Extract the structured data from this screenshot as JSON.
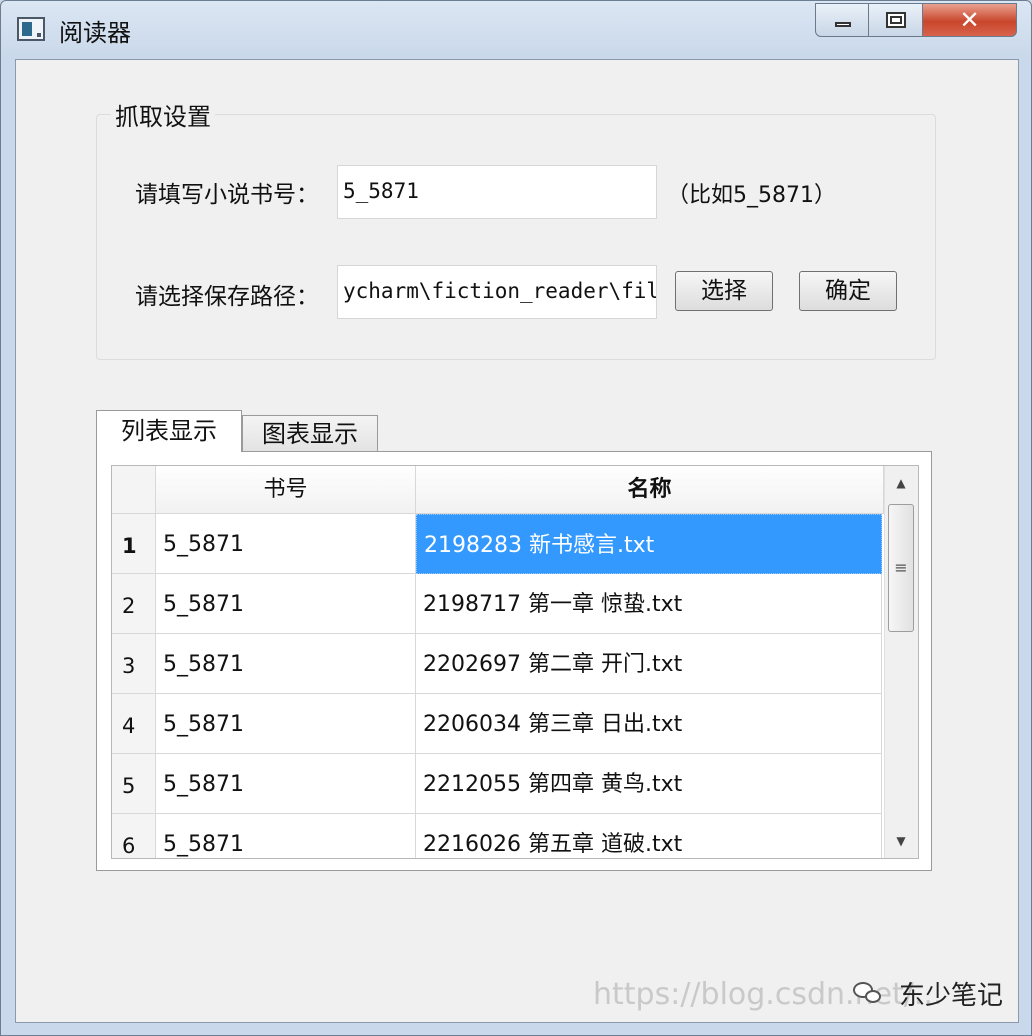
{
  "window": {
    "title": "阅读器",
    "controls": {
      "minimize": "minimize",
      "maximize": "maximize",
      "close": "✕"
    }
  },
  "settings": {
    "group_title": "抓取设置",
    "book_id_label": "请填写小说书号：",
    "book_id_value": "5_5871",
    "book_id_hint": "（比如5_5871）",
    "path_label": "请选择保存路径：",
    "path_value": "ycharm\\fiction_reader\\file",
    "choose_button": "选择",
    "confirm_button": "确定"
  },
  "tabs": [
    {
      "label": "列表显示",
      "active": true
    },
    {
      "label": "图表显示",
      "active": false
    }
  ],
  "table": {
    "columns": [
      "书号",
      "名称"
    ],
    "rows": [
      {
        "num": "1",
        "book_id": "5_5871",
        "name": "2198283 新书感言.txt",
        "selected": true
      },
      {
        "num": "2",
        "book_id": "5_5871",
        "name": "2198717 第一章 惊蛰.txt"
      },
      {
        "num": "3",
        "book_id": "5_5871",
        "name": "2202697 第二章 开门.txt"
      },
      {
        "num": "4",
        "book_id": "5_5871",
        "name": "2206034 第三章 日出.txt"
      },
      {
        "num": "5",
        "book_id": "5_5871",
        "name": "2212055 第四章 黄鸟.txt"
      },
      {
        "num": "6",
        "book_id": "5_5871",
        "name": "2216026 第五章 道破.txt"
      }
    ]
  },
  "watermark": {
    "url": "https://blog.csdn.net/...",
    "account": "东少笔记"
  }
}
